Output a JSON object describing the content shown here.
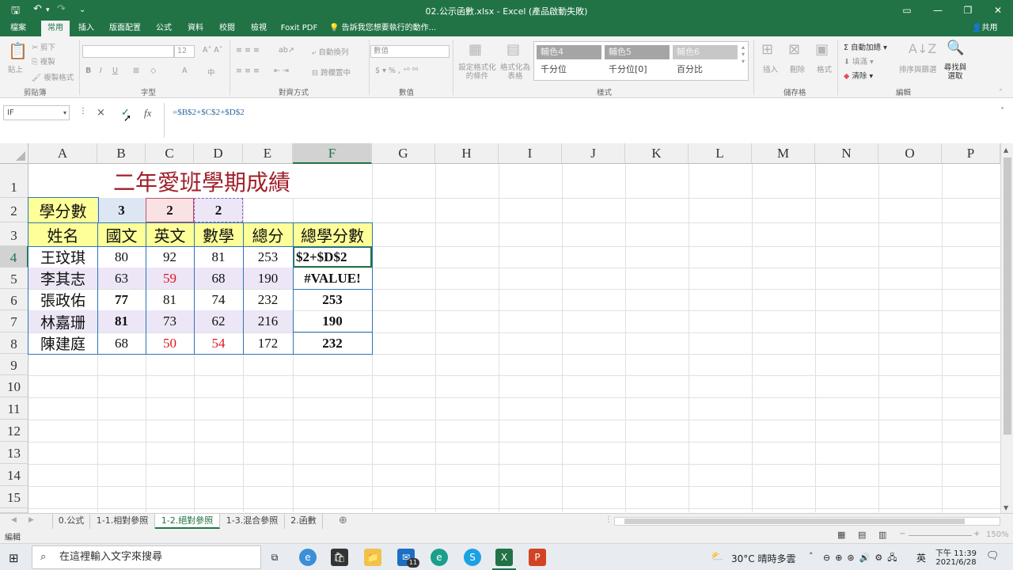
{
  "window": {
    "title": "02.公示函數.xlsx - Excel (產品啟動失敗)",
    "ribbon_display_icon": "ribbon-display-icon",
    "minimize_icon": "minimize-icon",
    "maximize_icon": "restore-icon",
    "close_icon": "close-icon"
  },
  "ribbon_tabs": [
    "檔案",
    "常用",
    "插入",
    "版面配置",
    "公式",
    "資料",
    "校閱",
    "檢視",
    "Foxit PDF"
  ],
  "active_tab": "常用",
  "tell_me": "告訴我您想要執行的動作...",
  "share": "共用",
  "clipboard": {
    "paste": "貼上",
    "cut": "剪下",
    "copy": "複製",
    "format_painter": "複製格式",
    "label": "剪貼簿"
  },
  "font": {
    "font_name": "",
    "font_size": "12",
    "label": "字型"
  },
  "alignment": {
    "wrap": "自動換列",
    "merge": "跨欄置中",
    "label": "對齊方式"
  },
  "number": {
    "format": "數值",
    "label": "數值"
  },
  "styles": {
    "conditional": "設定格式化的條件",
    "as_table": "格式化為表格",
    "items": [
      "輔色4",
      "輔色5",
      "輔色6",
      "千分位",
      "千分位[0]",
      "百分比"
    ],
    "label": "樣式"
  },
  "cells": {
    "insert": "插入",
    "delete": "刪除",
    "format": "格式",
    "label": "儲存格"
  },
  "editing": {
    "autosum": "自動加總",
    "fill": "填滿",
    "clear": "清除",
    "sort": "排序與篩選",
    "find": "尋找與選取",
    "label": "編輯"
  },
  "formula_bar": {
    "name_box": "IF",
    "cancel": "×",
    "enter": "✓",
    "fx": "fx",
    "formula": "=$B$2+$C$2+$D$2"
  },
  "columns": [
    "A",
    "B",
    "C",
    "D",
    "E",
    "F",
    "G",
    "H",
    "I",
    "J",
    "K",
    "L",
    "M",
    "N",
    "O",
    "P"
  ],
  "rows": [
    "1",
    "2",
    "3",
    "4",
    "5",
    "6",
    "7",
    "8",
    "9",
    "10",
    "11",
    "12",
    "13",
    "14",
    "15"
  ],
  "sheet": {
    "title": "二年愛班學期成績",
    "credit_label": "學分數",
    "credits": [
      "3",
      "2",
      "2"
    ],
    "headers": [
      "姓名",
      "國文",
      "英文",
      "數學",
      "總分",
      "總學分數"
    ],
    "students": [
      {
        "name": "王玟琪",
        "chinese": "80",
        "english": "92",
        "math": "81",
        "total": "253",
        "weighted": "$2+$D$2"
      },
      {
        "name": "李其志",
        "chinese": "63",
        "english": "59",
        "math": "68",
        "total": "190",
        "weighted": "#VALUE!"
      },
      {
        "name": "張政佑",
        "chinese": "77",
        "english": "81",
        "math": "74",
        "total": "232",
        "weighted": "253"
      },
      {
        "name": "林嘉珊",
        "chinese": "81",
        "english": "73",
        "math": "62",
        "total": "216",
        "weighted": "190"
      },
      {
        "name": "陳建庭",
        "chinese": "68",
        "english": "50",
        "math": "54",
        "total": "172",
        "weighted": "232"
      }
    ]
  },
  "sheet_tabs": [
    "0.公式",
    "1-1.相對參照",
    "1-2.絕對參照",
    "1-3.混合參照",
    "2.函數"
  ],
  "active_sheet": "1-2.絕對參照",
  "status": {
    "mode": "編輯",
    "zoom": "150%"
  },
  "taskbar": {
    "search_placeholder": "在這裡輸入文字來搜尋",
    "weather": "30°C 晴時多雲",
    "ime": "英",
    "time": "下午 11:39",
    "date": "2021/6/28",
    "mail_badge": "11"
  }
}
